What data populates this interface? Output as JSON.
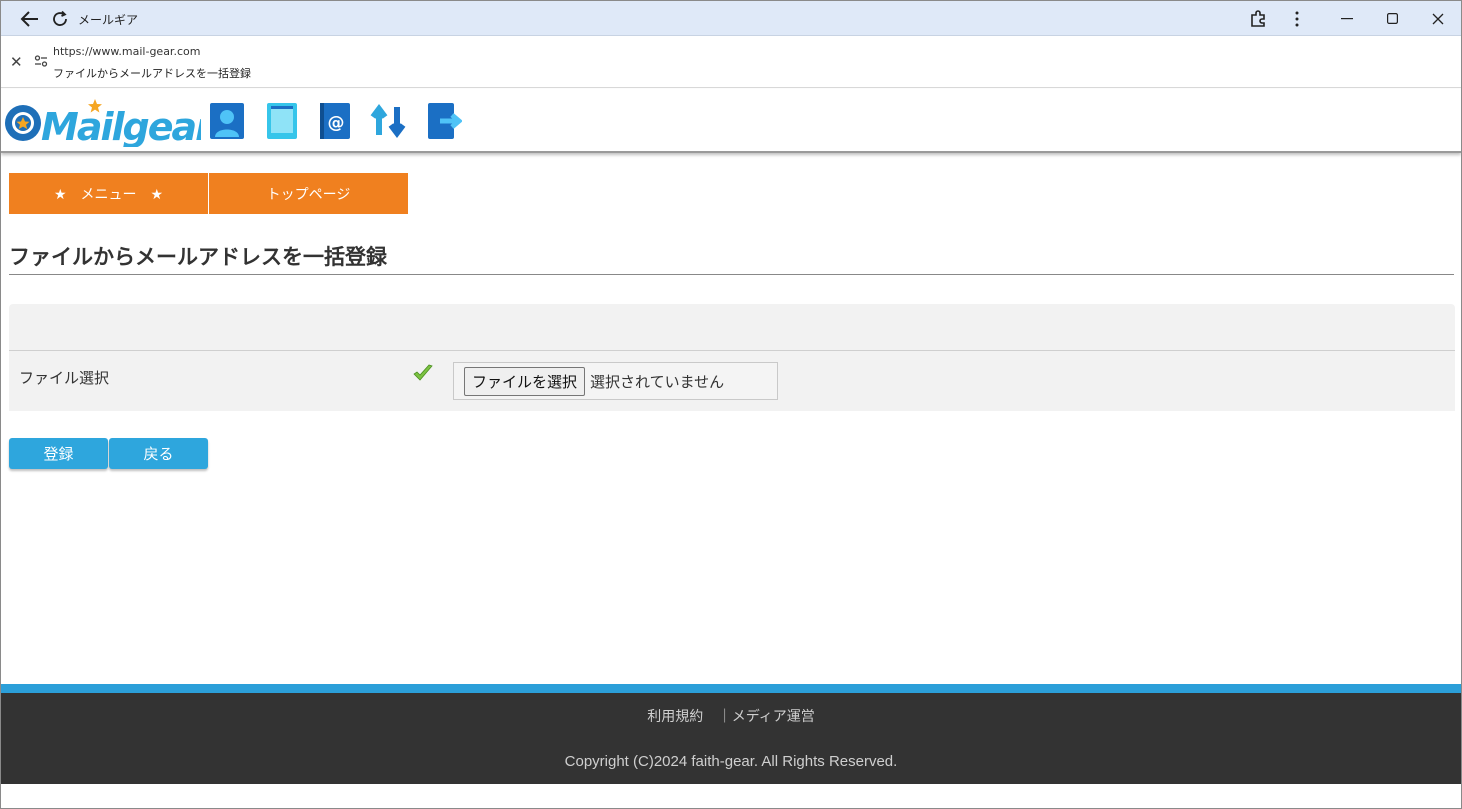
{
  "window": {
    "title": "メールギア"
  },
  "address": {
    "url": "https://www.mail-gear.com",
    "page_title": "ファイルからメールアドレスを一括登録"
  },
  "header": {
    "logo_text": "Mailgear",
    "nav_icons": [
      "user-icon",
      "book-icon",
      "address-book-icon",
      "sync-icon",
      "logout-icon"
    ]
  },
  "menu": {
    "menu_label": "★　メニュー　★",
    "top_label": "トップページ"
  },
  "page": {
    "heading": "ファイルからメールアドレスを一括登録"
  },
  "form": {
    "field_label": "ファイル選択",
    "file_button": "ファイルを選択",
    "file_status": "選択されていません"
  },
  "actions": {
    "register": "登録",
    "back": "戻る"
  },
  "footer": {
    "terms": "利用規約",
    "separator": "｜",
    "media": "メディア運営",
    "copyright": "Copyright (C)2024 faith-gear. All Rights Reserved."
  },
  "colors": {
    "accent_orange": "#f0801f",
    "accent_blue": "#2ea6dd",
    "footer_bg": "#333333"
  }
}
